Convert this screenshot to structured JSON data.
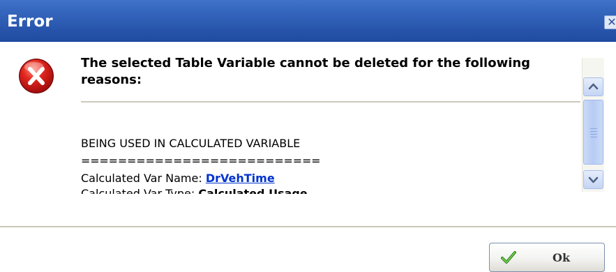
{
  "window": {
    "title": "Error",
    "close_glyph": "✕"
  },
  "icons": {
    "error": "error-x-icon",
    "ok": "check-icon",
    "close": "close-icon",
    "scroll_up": "chevron-up-icon",
    "scroll_down": "chevron-down-icon"
  },
  "message": {
    "heading": "The selected Table Variable cannot be deleted for the following reasons:",
    "reason_title": "BEING USED IN CALCULATED VARIABLE",
    "divider_text": "==========================",
    "var_name_label": "Calculated Var Name:",
    "var_name_value": "DrVehTime",
    "var_type_label": "Calculated Var Type:",
    "var_type_value": "Calculated Usage"
  },
  "buttons": {
    "ok_label": "Ok"
  },
  "colors": {
    "titlebar": "#2f5fb6",
    "link": "#0033cc",
    "error_red": "#d51a1a"
  }
}
